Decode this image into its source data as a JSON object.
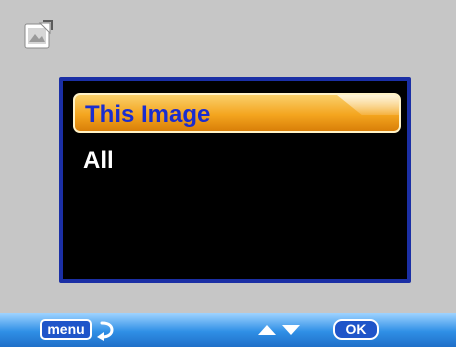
{
  "mode_icon": "playback-image-icon",
  "menu": {
    "items": [
      {
        "label": "This Image",
        "selected": true
      },
      {
        "label": "All",
        "selected": false
      }
    ]
  },
  "bottom_bar": {
    "menu_label": "menu",
    "return_icon": "return-arrow-icon",
    "nav_icon": "up-down-arrows-icon",
    "ok_label": "OK"
  },
  "colors": {
    "background": "#c6c6c6",
    "panel_border": "#1b2fa5",
    "panel_fill": "#000000",
    "selection_fill": "#f4a51f",
    "selected_text": "#1a2dcf",
    "normal_text": "#ffffff",
    "bar_blue": "#2f8fe6"
  }
}
